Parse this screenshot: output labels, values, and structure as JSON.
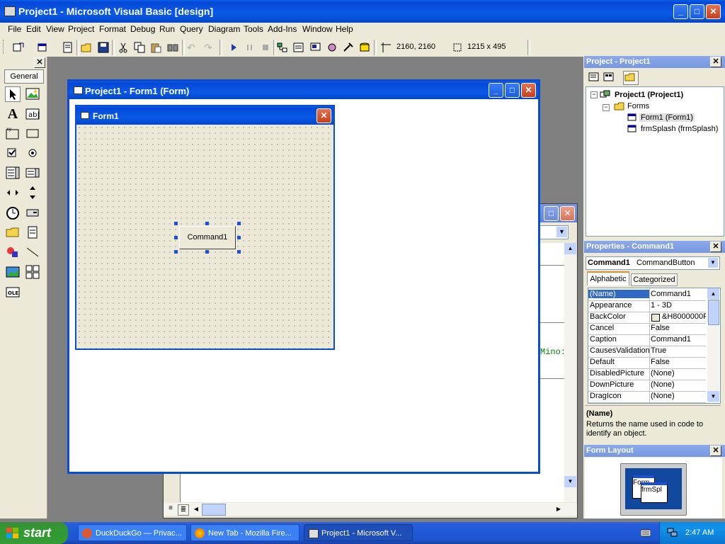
{
  "window": {
    "title": "Project1 - Microsoft Visual Basic [design]"
  },
  "menu": [
    {
      "label": "File"
    },
    {
      "label": "Edit"
    },
    {
      "label": "View"
    },
    {
      "label": "Project"
    },
    {
      "label": "Format"
    },
    {
      "label": "Debug"
    },
    {
      "label": "Run"
    },
    {
      "label": "Query"
    },
    {
      "label": "Diagram"
    },
    {
      "label": "Tools"
    },
    {
      "label": "Add-Ins"
    },
    {
      "label": "Window"
    },
    {
      "label": "Help"
    }
  ],
  "toolbar": {
    "position": "2160, 2160",
    "size": "1215 x 495"
  },
  "toolbox": {
    "tab_label": "General"
  },
  "form_window": {
    "title": "Project1 - Form1 (Form)"
  },
  "form": {
    "title": "Form1",
    "button_caption": "Command1"
  },
  "code_window": {
    "partial_text": "Mino:"
  },
  "project_explorer": {
    "title": "Project - Project1",
    "root": "Project1 (Project1)",
    "folder": "Forms",
    "items": [
      {
        "label": "Form1 (Form1)"
      },
      {
        "label": "frmSplash (frmSplash)"
      }
    ]
  },
  "properties": {
    "title": "Properties - Command1",
    "object_name": "Command1",
    "object_type": "CommandButton",
    "tabs": [
      {
        "label": "Alphabetic"
      },
      {
        "label": "Categorized"
      }
    ],
    "rows": [
      {
        "name": "(Name)",
        "value": "Command1"
      },
      {
        "name": "Appearance",
        "value": "1 - 3D"
      },
      {
        "name": "BackColor",
        "value": "&H8000000F"
      },
      {
        "name": "Cancel",
        "value": "False"
      },
      {
        "name": "Caption",
        "value": "Command1"
      },
      {
        "name": "CausesValidation",
        "value": "True"
      },
      {
        "name": "Default",
        "value": "False"
      },
      {
        "name": "DisabledPicture",
        "value": "(None)"
      },
      {
        "name": "DownPicture",
        "value": "(None)"
      },
      {
        "name": "DragIcon",
        "value": "(None)"
      }
    ],
    "desc_title": "(Name)",
    "desc_text": "Returns the name used in code to identify an object."
  },
  "form_layout": {
    "title": "Form Layout",
    "form1": "Form",
    "splash": "frmSpl"
  },
  "taskbar": {
    "start_label": "start",
    "items": [
      {
        "label": "DuckDuckGo — Privac..."
      },
      {
        "label": "New Tab - Mozilla Fire..."
      },
      {
        "label": "Project1 - Microsoft V..."
      }
    ],
    "clock": "2:47 AM"
  },
  "colors": {
    "accent": "#0a5ae8",
    "form_bg": "#ece9d8",
    "selection": "#316ac5"
  }
}
